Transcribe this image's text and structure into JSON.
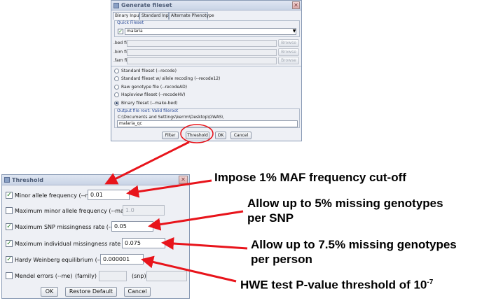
{
  "generate_dialog": {
    "title": "Generate fileset",
    "tabs": [
      "Binary Input",
      "Standard Input",
      "Alternate Phenotype"
    ],
    "quick_fileset_legend": "Quick Fileset",
    "quick_fileset_value": "malaria",
    "file_rows": [
      {
        "label": ".bed file",
        "browse": "Browse"
      },
      {
        "label": ".bim file",
        "browse": "Browse"
      },
      {
        "label": ".fam file",
        "browse": "Browse"
      }
    ],
    "radio_options": [
      {
        "label": "Standard fileset (--recode)",
        "checked": false
      },
      {
        "label": "Standard fileset w/ allele recoding (--recode12)",
        "checked": false
      },
      {
        "label": "Raw genotype file (--recodeAD)",
        "checked": false
      },
      {
        "label": "Haploview fileset (--recodeHV)",
        "checked": false
      },
      {
        "label": "Binary fileset (--make-bed)",
        "checked": true
      }
    ],
    "output_legend": "Output file root: Valid fileroot",
    "output_path": "C:\\Documents and Settings\\kerrm\\Desktop\\GWAS\\",
    "output_value": "malaria_qc",
    "buttons": {
      "filter": "Filter",
      "threshold": "Threshold",
      "ok": "OK",
      "cancel": "Cancel"
    }
  },
  "threshold_dialog": {
    "title": "Threshold",
    "rows": [
      {
        "label": "Minor allele frequency (--maf)",
        "checked": true,
        "value": "0.01"
      },
      {
        "label": "Maximum minor allele frequency (--max-maf)",
        "checked": false,
        "value": "1.0"
      },
      {
        "label": "Maximum SNP missingness rate (--geno)",
        "checked": true,
        "value": "0.05"
      },
      {
        "label": "Maximum individual missingness rate (--mind)",
        "checked": true,
        "value": "0.075"
      },
      {
        "label": "Hardy Weinberg equilibrium (--hwe)",
        "checked": true,
        "value": "0.000001"
      }
    ],
    "mendel": {
      "label": "Mendel errors (--me)",
      "family_label": "(family)",
      "snp_label": "(snp)",
      "checked": false
    },
    "buttons": {
      "ok": "OK",
      "restore": "Restore Default",
      "cancel": "Cancel"
    }
  },
  "annotations": {
    "maf": "Impose 1% MAF frequency cut-off",
    "geno_line1": "Allow up to 5% missing genotypes",
    "geno_line2": "per SNP",
    "mind_line1": "Allow up to 7.5% missing genotypes",
    "mind_line2": "per person",
    "hwe_text": "HWE test P-value threshold of 10",
    "hwe_exponent": "-7"
  },
  "colors": {
    "arrow": "#e8141b",
    "highlight_circle": "#e8141b"
  }
}
